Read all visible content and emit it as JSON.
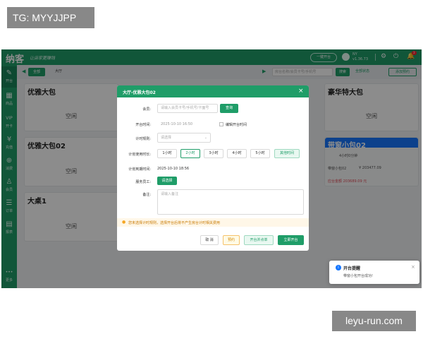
{
  "overlay_tag": "TG: MYYJJPP",
  "watermark": "leyu-run.com",
  "header": {
    "logo": "纳客",
    "slogan": "让店家更赚钱",
    "openroom_label": "一键开台",
    "user_name": "NY",
    "version": "v1.36.73",
    "notification_count": "3"
  },
  "sidebar": {
    "items": [
      {
        "label": "开台",
        "icon": "✎"
      },
      {
        "label": "商品",
        "icon": "▦"
      },
      {
        "label": "开卡",
        "icon": "VIP"
      },
      {
        "label": "充值",
        "icon": "¥"
      },
      {
        "label": "消费",
        "icon": "⊕"
      },
      {
        "label": "会员",
        "icon": "♙"
      },
      {
        "label": "订单",
        "icon": "☰"
      },
      {
        "label": "报表",
        "icon": "▤"
      },
      {
        "label": "更多",
        "icon": "•••"
      }
    ]
  },
  "toolbar": {
    "filter_all": "全部",
    "filter_hall": "大厅",
    "search_placeholder": "房台名称/会员卡号/手机号",
    "search_button": "搜索",
    "status_all": "全部状态",
    "add_reservation": "添加预约"
  },
  "rooms": [
    {
      "name": "优雅大包",
      "status": "空闲"
    },
    {
      "name": "豪华特大包",
      "status": "空闲"
    },
    {
      "name": "优雅大包02",
      "status": "空闲"
    },
    {
      "name": "大桌1",
      "status": "空闲"
    },
    {
      "name": "空闲"
    },
    {
      "name": "空闲"
    },
    {
      "name": "空闲"
    },
    {
      "name": "空闲"
    },
    {
      "name": "空闲"
    }
  ],
  "busy_room": {
    "name": "带窗小包02",
    "line1": "4小时0分钟",
    "line2": "带窗小包02",
    "line3": "¥ 203477.09",
    "line4": "应台金额 203689.09 元"
  },
  "modal": {
    "title": "大厅-优雅大包02",
    "member_label": "会员:",
    "member_placeholder": "请输入会员卡号/手机号/卡面号",
    "member_query": "查询",
    "start_label": "开台时间:",
    "start_value": "2025-10-10 16:50",
    "edit_start": "编辑开台时间",
    "rule_label": "计时规则:",
    "rule_placeholder": "请选择",
    "duration_label": "计划使用时长:",
    "durations": [
      "1小时",
      "2小时",
      "3小时",
      "4小时",
      "5小时"
    ],
    "duration_other": "其他时间",
    "end_label": "计划到期时间:",
    "end_value": "2025-10-10 18:56",
    "staff_label": "服务员工:",
    "staff_button": "请选择",
    "remark_label": "备注:",
    "remark_placeholder": "请输入备注",
    "notice": "您未选择计时规则，选择开台后将不产生房台计时相关费用",
    "btn_cancel": "取 消",
    "btn_reserve": "预约",
    "btn_open_order": "开台并点单",
    "btn_open_now": "立即开台"
  },
  "toast": {
    "title": "开台提醒",
    "message": "带窗小包开台成功!"
  }
}
